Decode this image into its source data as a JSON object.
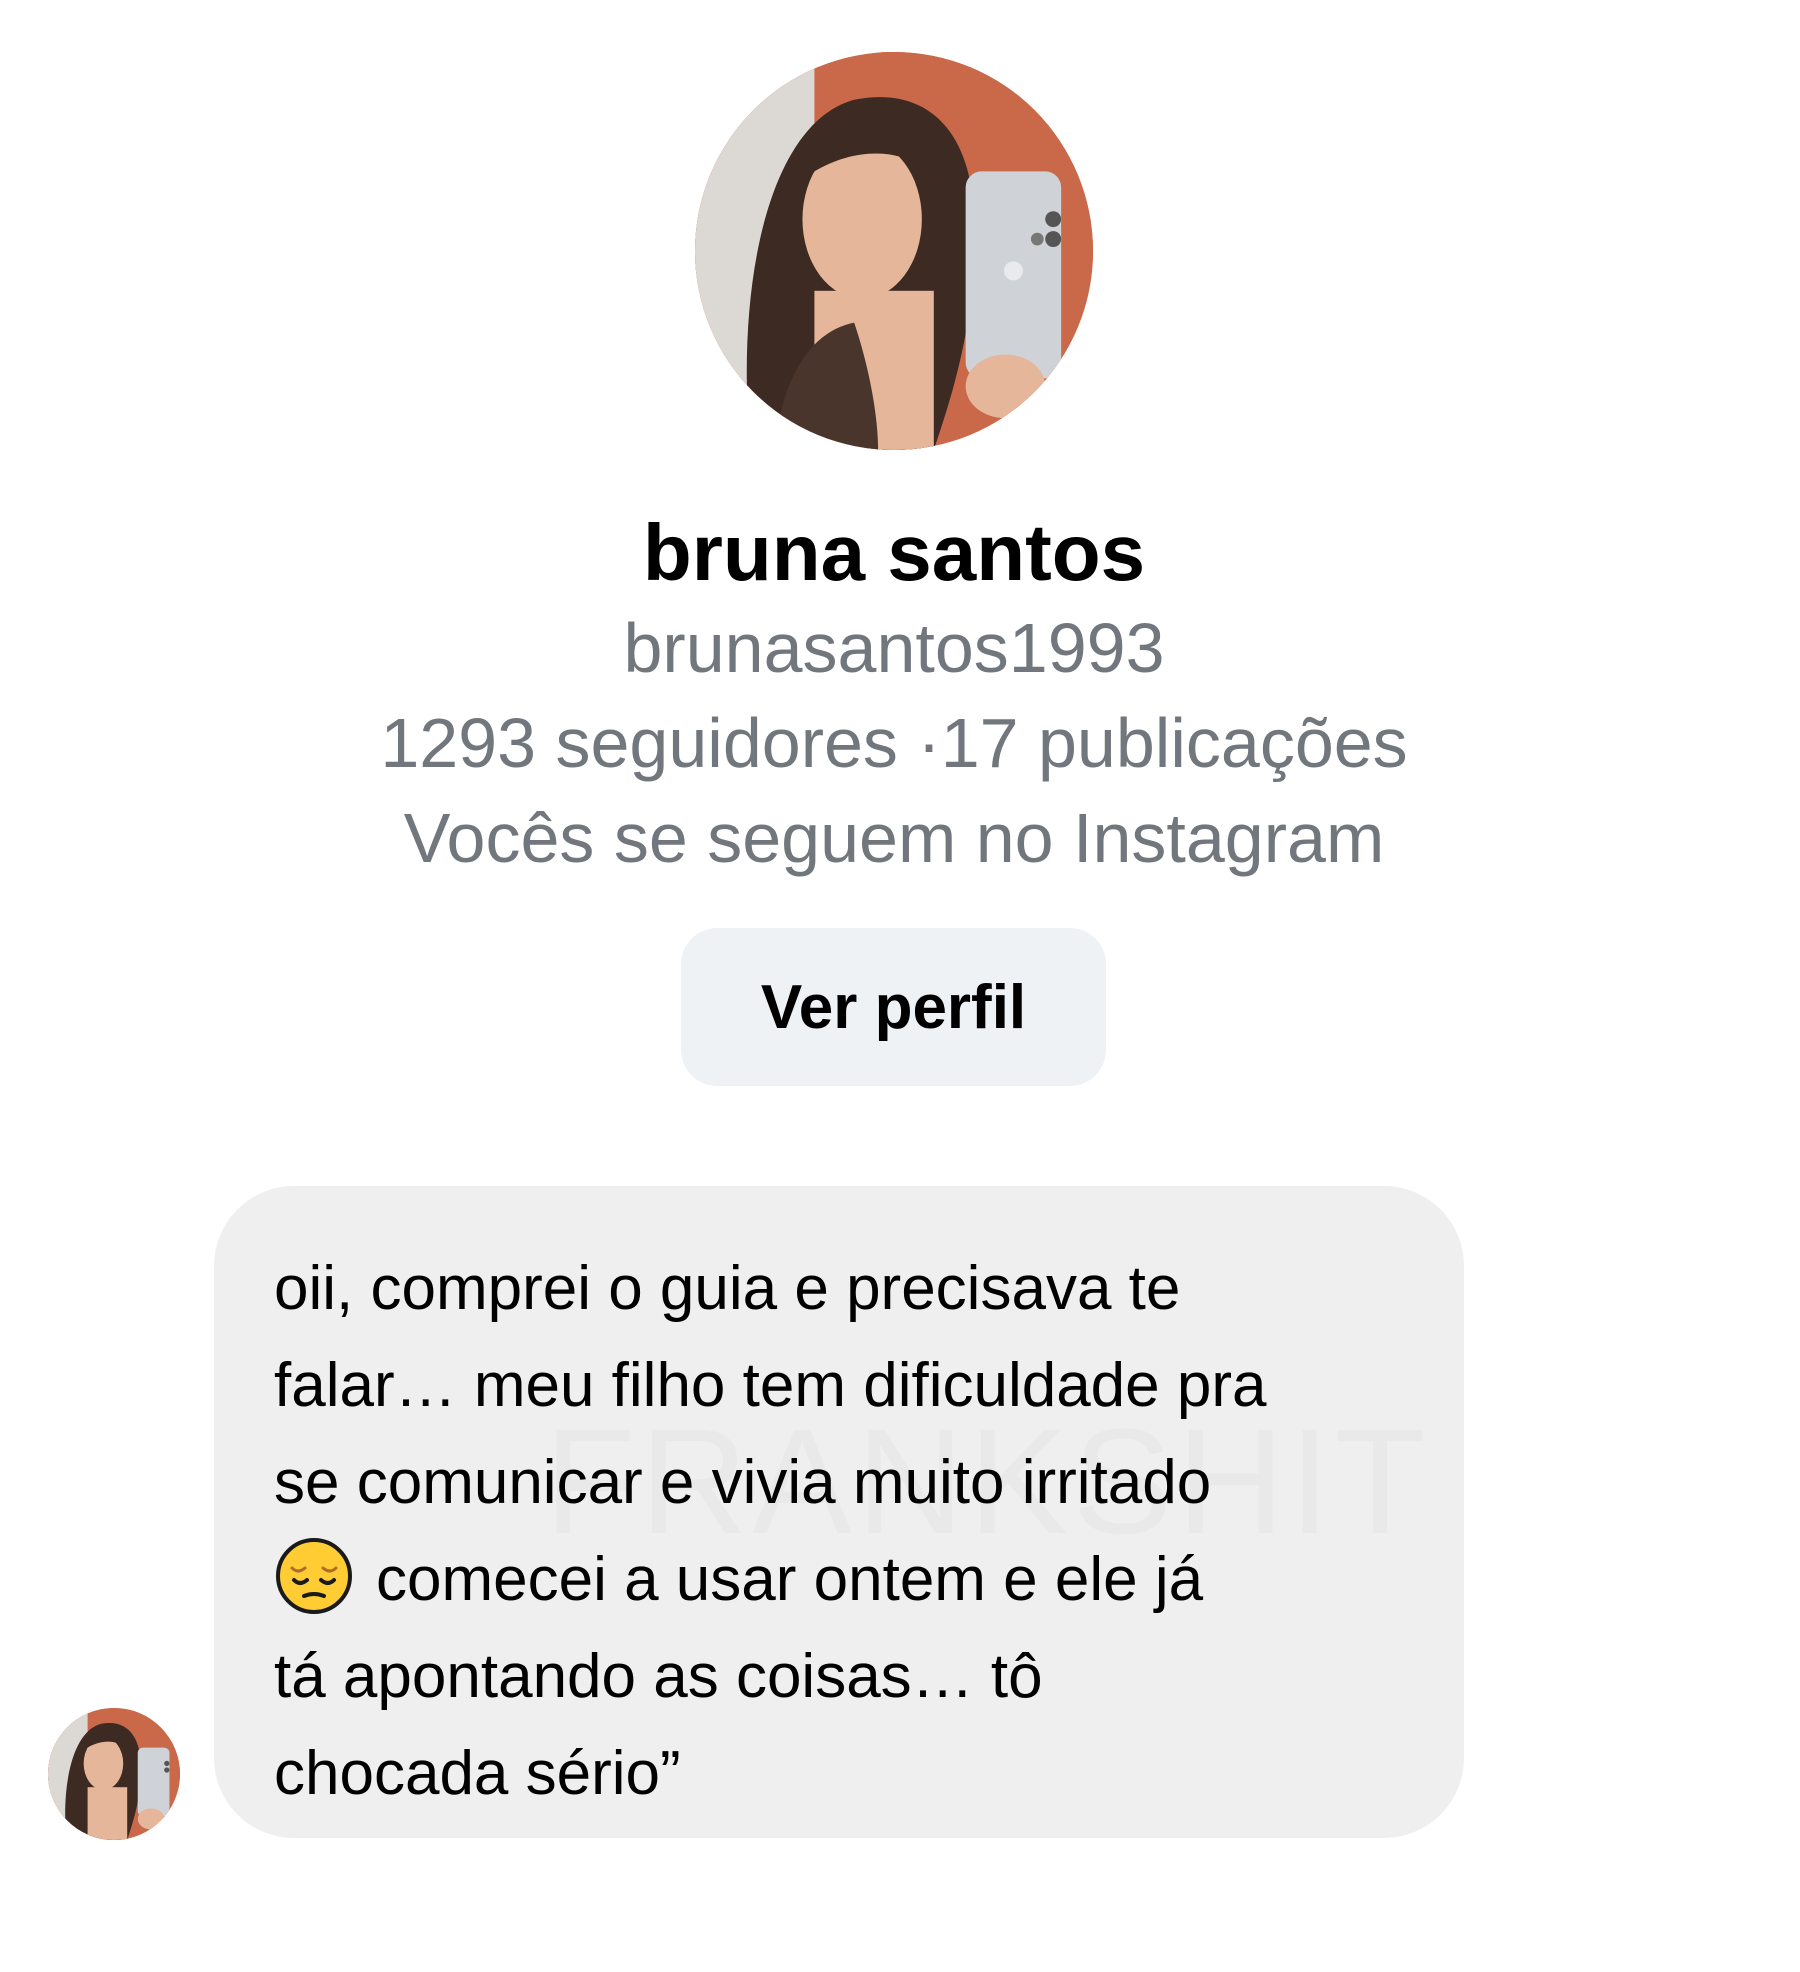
{
  "profile": {
    "name": "bruna santos",
    "username": "brunasantos1993",
    "stats": "1293 seguidores ·17 publicações",
    "mutual": "Vocês se seguem no Instagram",
    "view_profile_label": "Ver perfil"
  },
  "message": {
    "lines": [
      "oii, comprei o guia e precisava te",
      "falar… meu filho tem dificuldade pra",
      "se comunicar e vivia muito irritado",
      "comecei a usar ontem e ele já",
      "tá apontando as coisas… tô",
      "chocada sério”"
    ],
    "emoji_icon": "pensive-face-icon",
    "watermark": "FRANKSHIT"
  },
  "colors": {
    "secondary_text": "#72767d",
    "button_bg": "#eff2f5",
    "bubble_bg": "#efefef",
    "avatar_bg": "#c9694a"
  }
}
